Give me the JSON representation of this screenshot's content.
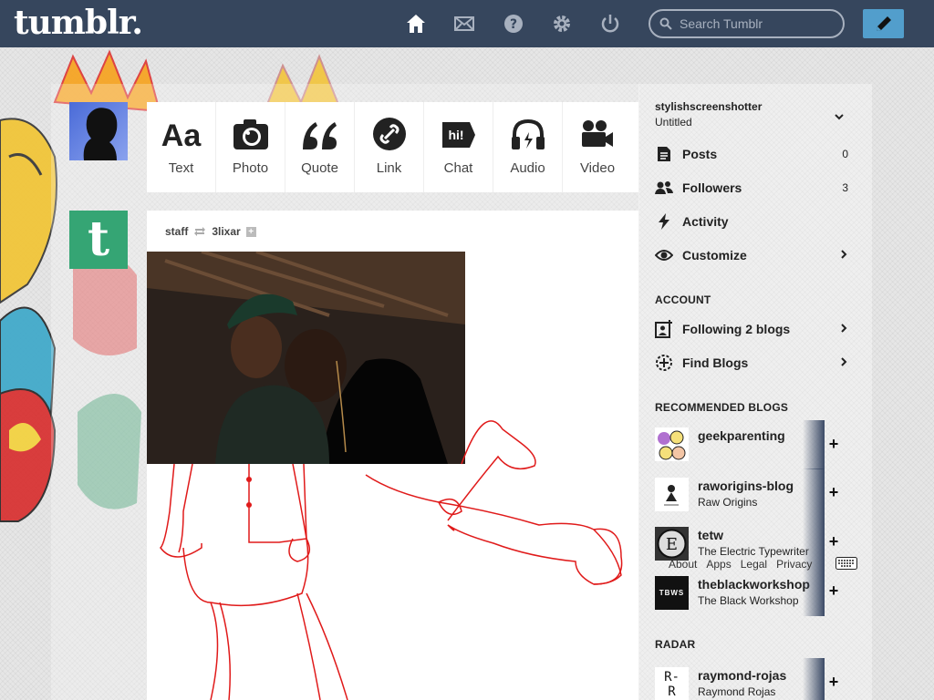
{
  "header": {
    "logo": "tumblr.",
    "search_placeholder": "Search Tumblr",
    "nav": [
      {
        "icon": "home-icon"
      },
      {
        "icon": "messages-icon"
      },
      {
        "icon": "help-icon"
      },
      {
        "icon": "settings-icon"
      },
      {
        "icon": "logout-icon"
      }
    ],
    "compose_icon": "pencil-icon",
    "bar_color": "#36465d",
    "accent_color": "#529ecc"
  },
  "post_types": [
    {
      "label": "Text",
      "icon": "text-icon"
    },
    {
      "label": "Photo",
      "icon": "camera-icon"
    },
    {
      "label": "Quote",
      "icon": "quote-icon"
    },
    {
      "label": "Link",
      "icon": "link-icon"
    },
    {
      "label": "Chat",
      "icon": "chat-icon"
    },
    {
      "label": "Audio",
      "icon": "headphones-icon"
    },
    {
      "label": "Video",
      "icon": "video-camera-icon"
    }
  ],
  "post": {
    "author": "staff",
    "reblogged_from": "3lixar"
  },
  "sidebar": {
    "blog_name": "stylishscreenshotter",
    "blog_title": "Untitled",
    "menu": [
      {
        "label": "Posts",
        "count": "0",
        "icon": "posts-icon"
      },
      {
        "label": "Followers",
        "count": "3",
        "icon": "followers-icon"
      },
      {
        "label": "Activity",
        "count": "",
        "icon": "activity-icon"
      },
      {
        "label": "Customize",
        "count": "",
        "icon": "eye-icon"
      }
    ],
    "account_title": "ACCOUNT",
    "account": [
      {
        "label": "Following 2 blogs",
        "icon": "following-icon"
      },
      {
        "label": "Find Blogs",
        "icon": "find-blogs-icon"
      }
    ],
    "recommended_title": "RECOMMENDED BLOGS",
    "recommended": [
      {
        "name": "geekparenting",
        "title": ""
      },
      {
        "name": "raworigins-blog",
        "title": "Raw Origins"
      },
      {
        "name": "tetw",
        "title": "The Electric Typewriter"
      },
      {
        "name": "theblackworkshop",
        "title": "The Black Workshop",
        "avatar_text": "TBWS"
      }
    ],
    "footer_links": [
      "About",
      "Apps",
      "Legal",
      "Privacy"
    ],
    "radar_title": "RADAR",
    "radar": {
      "name": "raymond-rojas",
      "title": "Raymond Rojas",
      "avatar_text": "R-R"
    }
  }
}
